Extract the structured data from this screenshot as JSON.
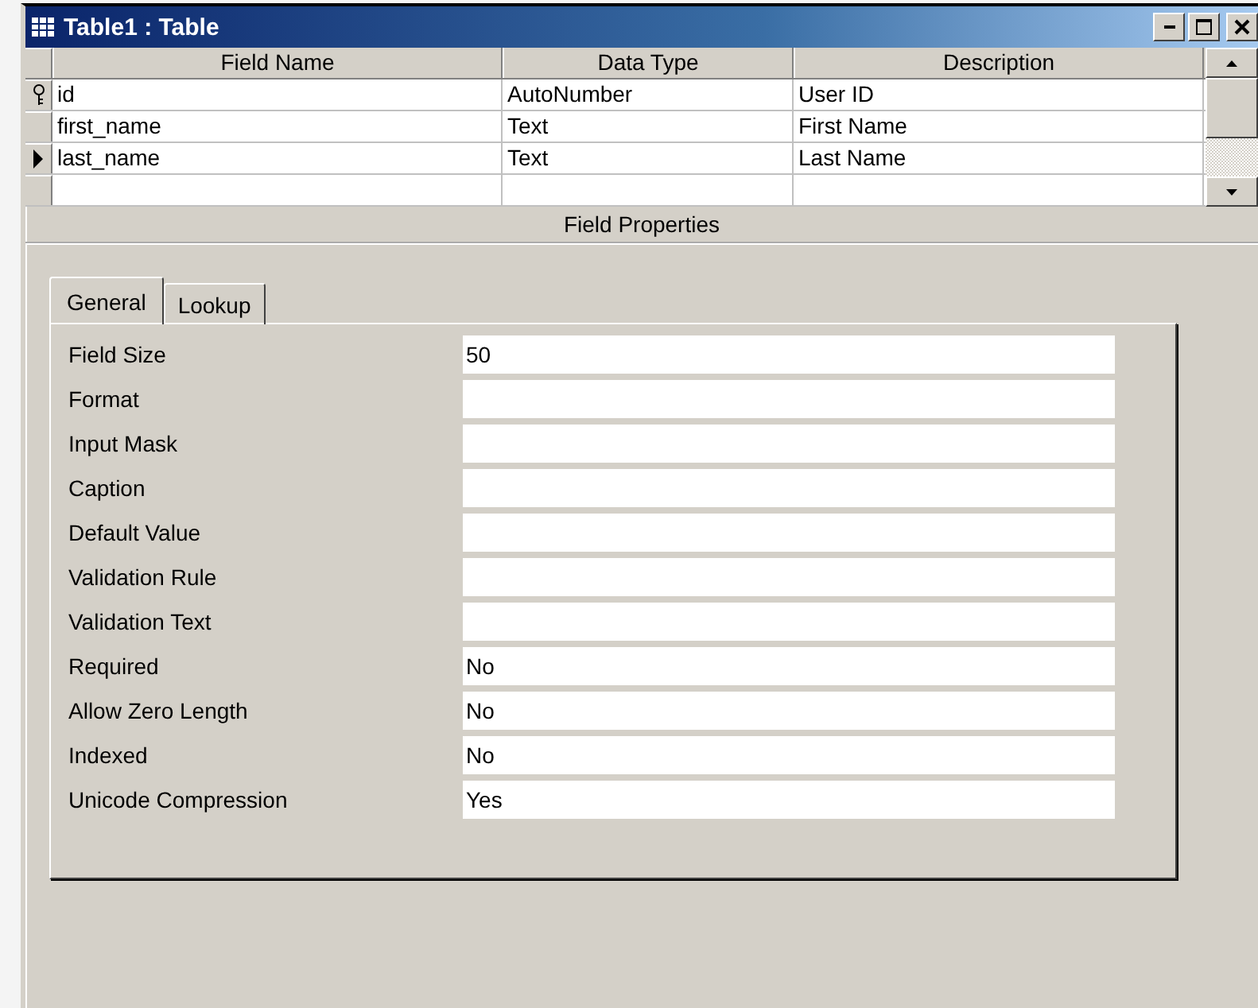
{
  "window": {
    "title": "Table1 : Table"
  },
  "grid": {
    "columns": [
      "Field Name",
      "Data Type",
      "Description"
    ],
    "rows": [
      {
        "cells": [
          "id",
          "AutoNumber",
          "User ID"
        ],
        "primary_key": true,
        "current": false
      },
      {
        "cells": [
          "first_name",
          "Text",
          "First Name"
        ],
        "primary_key": false,
        "current": false
      },
      {
        "cells": [
          "last_name",
          "Text",
          "Last Name"
        ],
        "primary_key": false,
        "current": true
      },
      {
        "primary_key": false,
        "current": false
      }
    ]
  },
  "field_properties": {
    "title": "Field Properties",
    "tabs": [
      {
        "label": "General",
        "selected": true
      },
      {
        "label": "Lookup",
        "selected": false
      }
    ],
    "properties": [
      {
        "label": "Field Size",
        "value": "50"
      },
      {
        "label": "Format"
      },
      {
        "label": "Input Mask"
      },
      {
        "label": "Caption"
      },
      {
        "label": "Default Value"
      },
      {
        "label": "Validation Rule"
      },
      {
        "label": "Validation Text"
      },
      {
        "label": "Required",
        "value": "No"
      },
      {
        "label": "Allow Zero Length",
        "value": "No"
      },
      {
        "label": "Indexed",
        "value": "No"
      },
      {
        "label": "Unicode Compression",
        "value": "Yes"
      }
    ]
  }
}
